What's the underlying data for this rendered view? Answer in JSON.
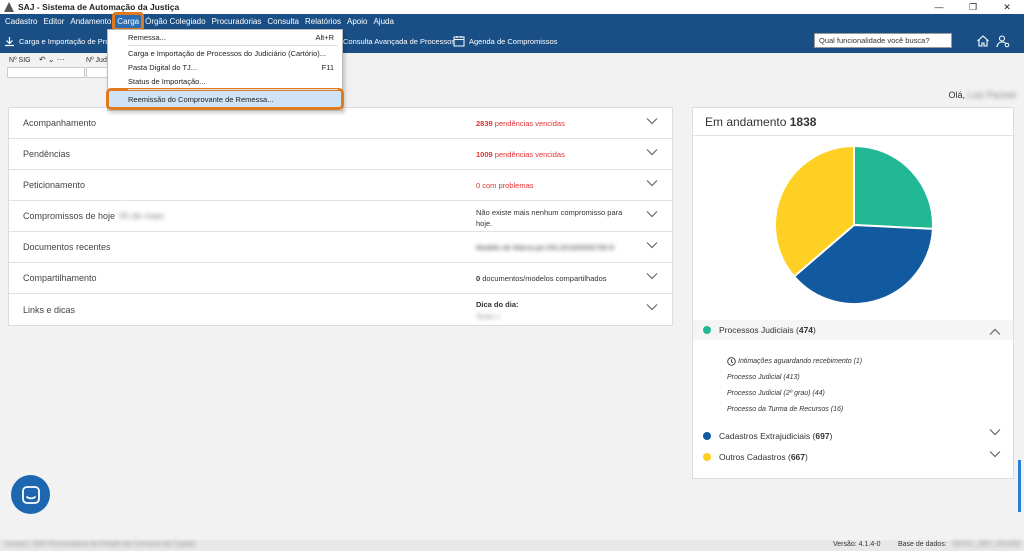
{
  "window": {
    "title": "SAJ - Sistema de Automação da Justiça"
  },
  "menu": {
    "items": [
      "Cadastro",
      "Editor",
      "Andamento",
      "Carga",
      "Órgão Colegiado",
      "Procuradorias",
      "Consulta",
      "Relatórios",
      "Apoio",
      "Ajuda"
    ],
    "active": "Carga"
  },
  "toolbar": {
    "carga_import": "Carga e Importação de Pro",
    "consulta_avancada": "Consulta Avançada de Processos",
    "agenda": "Agenda de Compromissos",
    "search_placeholder": "Qual funcionalidade você busca?"
  },
  "fields": {
    "sig_label": "Nº SIG",
    "jud_label": "Nº Jud"
  },
  "greeting": {
    "prefix": "Olá,",
    "name": "Luiz Pacheli"
  },
  "dropdown": {
    "items": [
      {
        "label": "Remessa...",
        "shortcut": "Alt+R"
      },
      {
        "label": "Carga e Importação de Processos do Judiciário (Cartório)...",
        "shortcut": ""
      },
      {
        "label": "Pasta Digital do TJ...",
        "shortcut": "F11"
      },
      {
        "label": "Status de Importação...",
        "shortcut": ""
      },
      {
        "label": "Reemissão do Comprovante de Remessa...",
        "shortcut": ""
      }
    ]
  },
  "panel": {
    "rows": [
      {
        "label": "Acompanhamento",
        "label_extra": "",
        "info_bold": "2839",
        "info": " pendências vencidas",
        "info2": "",
        "red": true
      },
      {
        "label": "Pendências",
        "label_extra": "",
        "info_bold": "1009",
        "info": " pendências vencidas",
        "info2": "",
        "red": true
      },
      {
        "label": "Peticionamento",
        "label_extra": "",
        "info_bold": "0",
        "info": " com problemas",
        "info2": "",
        "red": true
      },
      {
        "label": "Compromissos de hoje",
        "label_extra": "05 de maio",
        "info_bold": "",
        "info": "Não existe mais nenhum compromisso para",
        "info2": "hoje.",
        "red": false
      },
      {
        "label": "Documentos recentes",
        "label_extra": "",
        "info_bold": "",
        "info": "Modelo de Marca.pe.DN.2016/0000700-8",
        "info2": "",
        "red": false,
        "blur": true
      },
      {
        "label": "Compartilhamento",
        "label_extra": "",
        "info_bold": "0",
        "info": " documentos/modelos compartilhados",
        "info2": "",
        "red": false
      },
      {
        "label": "Links e dicas",
        "label_extra": "",
        "info_bold": "Dica do dia:",
        "info": "",
        "info2": "Texto 1",
        "red": false,
        "blur2": true
      }
    ]
  },
  "chart_data": {
    "type": "pie",
    "title": "Em andamento",
    "total": "1838",
    "slices": [
      {
        "name": "Processos Judiciais",
        "value": 474,
        "color": "#22b896"
      },
      {
        "name": "Cadastros Extrajudiciais",
        "value": 697,
        "color": "#125aa0"
      },
      {
        "name": "Outros Cadastros",
        "value": 667,
        "color": "#ffd024"
      }
    ],
    "subitems": [
      "Intimações aguardando recebimento (1)",
      "Processo Judicial (413)",
      "Processo Judicial (2º grau) (44)",
      "Processo da Turma de Recursos (16)"
    ]
  },
  "footer": {
    "left": "Usuário: SAP Procuradoria do Estado da Comarca da Capital",
    "version": "Versão: 4.1.4-0",
    "db_label": "Base de dados:",
    "db_value": "SRV01_DEV_0010SE"
  }
}
